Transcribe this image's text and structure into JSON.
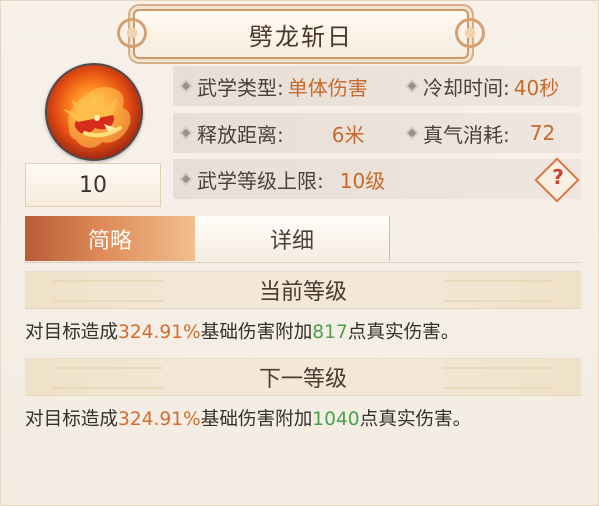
{
  "skill": {
    "title": "劈龙斩日",
    "level": "10",
    "icon_name": "dragon-fire-icon"
  },
  "stats": {
    "type_label": "武学类型:",
    "type_value": "单体伤害",
    "cooldown_label": "冷却时间:",
    "cooldown_value": "40秒",
    "range_label": "释放距离:",
    "range_value": "6米",
    "energy_label": "真气消耗:",
    "energy_value": "72",
    "max_level_label": "武学等级上限:",
    "max_level_value": "10级",
    "help_mark": "?"
  },
  "tabs": {
    "summary": "简略",
    "detail": "详细"
  },
  "sections": {
    "current_level": "当前等级",
    "next_level": "下一等级",
    "current_text": {
      "prefix": "对目标造成",
      "percent": "324.91%",
      "middle": "基础伤害附加",
      "bonus": "817",
      "suffix": "点真实伤害。"
    },
    "next_text": {
      "prefix": "对目标造成",
      "percent": "324.91%",
      "middle": "基础伤害附加",
      "bonus": "1040",
      "suffix": "点真实伤害。"
    }
  },
  "colors": {
    "accent_orange": "#d26d2d",
    "accent_green": "#49a24b",
    "tab_active": "#c86a3d"
  }
}
